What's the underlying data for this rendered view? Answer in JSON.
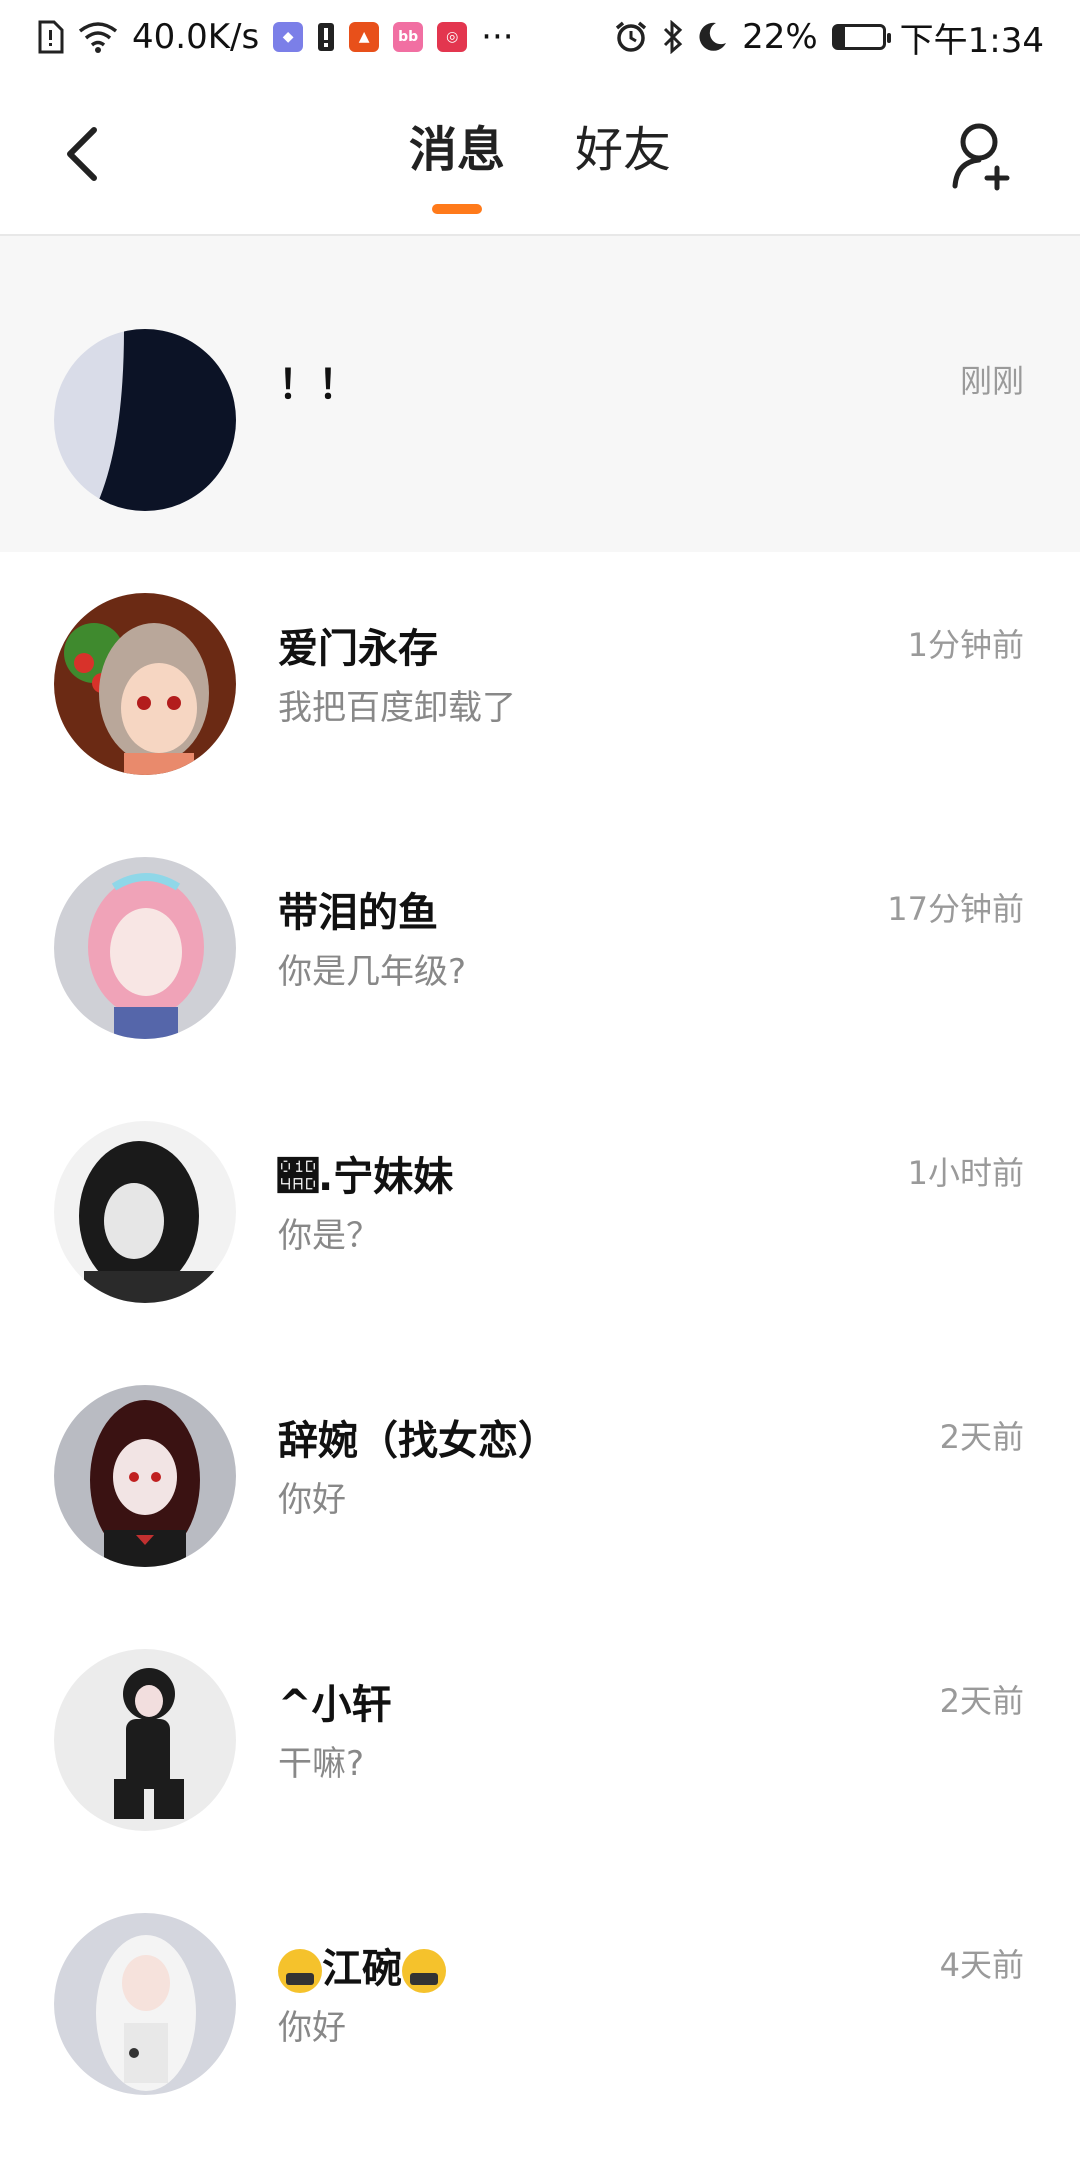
{
  "status_bar": {
    "net_speed": "40.0K/s",
    "battery": "22%",
    "time": "下午1:34",
    "more": "···"
  },
  "header": {
    "back_icon": "chevron-left-icon",
    "tabs": [
      {
        "label": "消息",
        "active": true
      },
      {
        "label": "好友",
        "active": false
      }
    ],
    "add_friend_icon": "add-friend-icon",
    "accent": "#ff7a1a"
  },
  "conversations": [
    {
      "name": "！！",
      "preview": "",
      "time": "刚刚",
      "highlight": true
    },
    {
      "name": "爱门永存",
      "preview": "我把百度卸载了",
      "time": "1分钟前"
    },
    {
      "name": "带泪的鱼",
      "preview": "你是几年级?",
      "time": "17分钟前"
    },
    {
      "name": "𝒭.宁妹妹",
      "preview": "你是？",
      "time": "1小时前"
    },
    {
      "name": "辞婉（找女恋）",
      "preview": "你好",
      "time": "2天前"
    },
    {
      "name": "^小轩",
      "preview": "干嘛?",
      "time": "2天前"
    },
    {
      "name": "江碗",
      "preview": "你好",
      "time": "4天前"
    }
  ]
}
